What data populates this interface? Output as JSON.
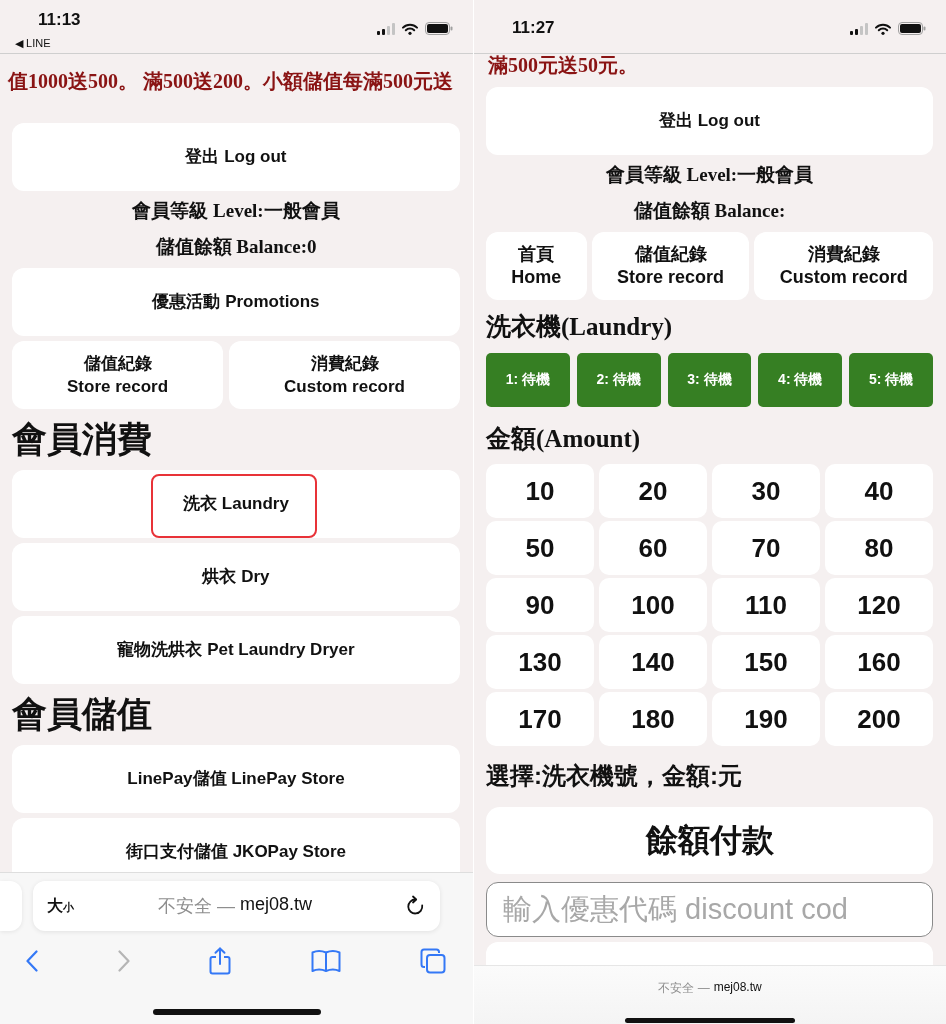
{
  "screenshots": [
    {
      "status_bar": {
        "time": "11:13",
        "back_link": "◀ LINE"
      },
      "content": [
        {
          "kind": "marquee",
          "text": "值1000送500。 滿500送200。小額儲值每滿500元送"
        },
        {
          "kind": "button",
          "label": "登出 Log out",
          "highlighted": false
        },
        {
          "kind": "info",
          "text": "會員等級 Level:一般會員"
        },
        {
          "kind": "info",
          "text": "儲值餘額 Balance:0"
        },
        {
          "kind": "button",
          "label": "優惠活動 Promotions",
          "highlighted": false
        },
        {
          "kind": "button_row",
          "buttons": [
            {
              "label": "儲值紀錄",
              "sublabel": "Store record"
            },
            {
              "label": "消費紀錄",
              "sublabel": "Custom record"
            }
          ]
        },
        {
          "kind": "section_heading",
          "text": "會員消費"
        },
        {
          "kind": "button",
          "label": "洗衣 Laundry",
          "highlighted": true
        },
        {
          "kind": "button",
          "label": "烘衣 Dry",
          "highlighted": false
        },
        {
          "kind": "button",
          "label": "寵物洗烘衣 Pet Laundry Dryer",
          "highlighted": false
        },
        {
          "kind": "section_heading",
          "text": "會員儲值"
        },
        {
          "kind": "button",
          "label": "LinePay儲值 LinePay Store",
          "highlighted": false
        },
        {
          "kind": "button",
          "label": "街口支付儲值 JKOPay Store",
          "highlighted": false
        }
      ],
      "browser_bar": {
        "kind": "full",
        "text_size_button": "大$_{小}$",
        "security": "不安全 —",
        "domain": "mej08.tw",
        "toolbar": [
          {
            "kind": "back",
            "disabled": false
          },
          {
            "kind": "forward",
            "disabled": true
          },
          {
            "kind": "share",
            "disabled": false
          },
          {
            "kind": "bookmarks",
            "disabled": false
          },
          {
            "kind": "tabs",
            "disabled": false
          }
        ]
      }
    },
    {
      "status_bar": {
        "time": "11:27"
      },
      "content": [
        {
          "kind": "marquee",
          "text": "滿500元送50元。"
        },
        {
          "kind": "button",
          "label": "登出 Log out",
          "highlighted": false
        },
        {
          "kind": "info",
          "text": "會員等級 Level:一般會員"
        },
        {
          "kind": "info",
          "text": "儲值餘額 Balance:"
        },
        {
          "kind": "button_row",
          "buttons": [
            {
              "label": "首頁",
              "sublabel": "Home"
            },
            {
              "label": "儲值紀錄",
              "sublabel": "Store record"
            },
            {
              "label": "消費紀錄",
              "sublabel": "Custom record"
            }
          ]
        },
        {
          "kind": "subheading",
          "text": "洗衣機(Laundry)"
        },
        {
          "kind": "machine_row",
          "machines": [
            {
              "label": "1: 待機",
              "selected": false
            },
            {
              "label": "2: 待機",
              "selected": false
            },
            {
              "label": "3: 待機",
              "selected": false
            },
            {
              "label": "4: 待機",
              "selected": false
            },
            {
              "label": "5: 待機",
              "selected": false
            }
          ]
        },
        {
          "kind": "subheading",
          "text": "金額(Amount)"
        },
        {
          "kind": "amount_grid",
          "amounts": [
            {
              "label": "10",
              "selected": false
            },
            {
              "label": "20",
              "selected": false
            },
            {
              "label": "30",
              "selected": false
            },
            {
              "label": "40",
              "selected": false
            },
            {
              "label": "50",
              "selected": false
            },
            {
              "label": "60",
              "selected": false
            },
            {
              "label": "70",
              "selected": false
            },
            {
              "label": "80",
              "selected": false
            },
            {
              "label": "90",
              "selected": false
            },
            {
              "label": "100",
              "selected": false
            },
            {
              "label": "110",
              "selected": false
            },
            {
              "label": "120",
              "selected": false
            },
            {
              "label": "130",
              "selected": false
            },
            {
              "label": "140",
              "selected": false
            },
            {
              "label": "150",
              "selected": false
            },
            {
              "label": "160",
              "selected": false
            },
            {
              "label": "170",
              "selected": false
            },
            {
              "label": "180",
              "selected": false
            },
            {
              "label": "190",
              "selected": false
            },
            {
              "label": "200",
              "selected": false
            }
          ]
        },
        {
          "kind": "selection_text",
          "text": "選擇:洗衣機號，金額:元"
        },
        {
          "kind": "primary_button",
          "label": "餘額付款"
        },
        {
          "kind": "input",
          "placeholder": "輸入優惠代碼 discount cod"
        },
        {
          "kind": "cut_button"
        }
      ],
      "browser_bar": {
        "kind": "compact",
        "security": "不安全 —",
        "domain": "mej08.tw"
      }
    }
  ]
}
